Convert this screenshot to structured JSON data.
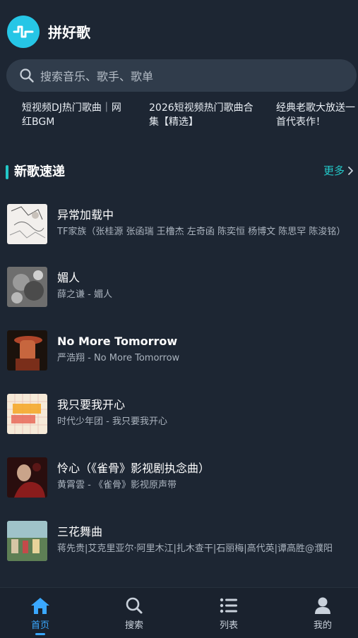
{
  "app": {
    "title": "拼好歌",
    "accent": "#26c6e6"
  },
  "search": {
    "placeholder": "搜索音乐、歌手、歌单"
  },
  "hot_searches": [
    "短视频DJ热门歌曲｜网红BGM",
    "2026短视频热门歌曲合集【精选】",
    "经典老歌大放送一首代表作！"
  ],
  "section": {
    "title": "新歌速递",
    "more_label": "更多"
  },
  "songs": [
    {
      "title": "异常加载中",
      "subtitle": "TF家族（张桂源 张函瑞 王橹杰 左奇函 陈奕恒 杨博文 陈思罕 陈浚铭）"
    },
    {
      "title": "媚人",
      "subtitle": "薛之谦 - 媚人"
    },
    {
      "title": "No More Tomorrow",
      "subtitle": "严浩翔 - No More Tomorrow"
    },
    {
      "title": "我只要我开心",
      "subtitle": "时代少年团 - 我只要我开心"
    },
    {
      "title": "怜心（《雀骨》影视剧执念曲）",
      "subtitle": "黄霄雲 - 《雀骨》影视原声带"
    },
    {
      "title": "三花舞曲",
      "subtitle": "蒋先贵|艾克里亚尔·阿里木江|扎木查干|石丽梅|高代英|谭高胜@濮阳"
    }
  ],
  "tabs": [
    {
      "label": "首页",
      "icon": "home-icon",
      "active": true
    },
    {
      "label": "搜索",
      "icon": "search-icon",
      "active": false
    },
    {
      "label": "列表",
      "icon": "list-icon",
      "active": false
    },
    {
      "label": "我的",
      "icon": "user-icon",
      "active": false
    }
  ]
}
